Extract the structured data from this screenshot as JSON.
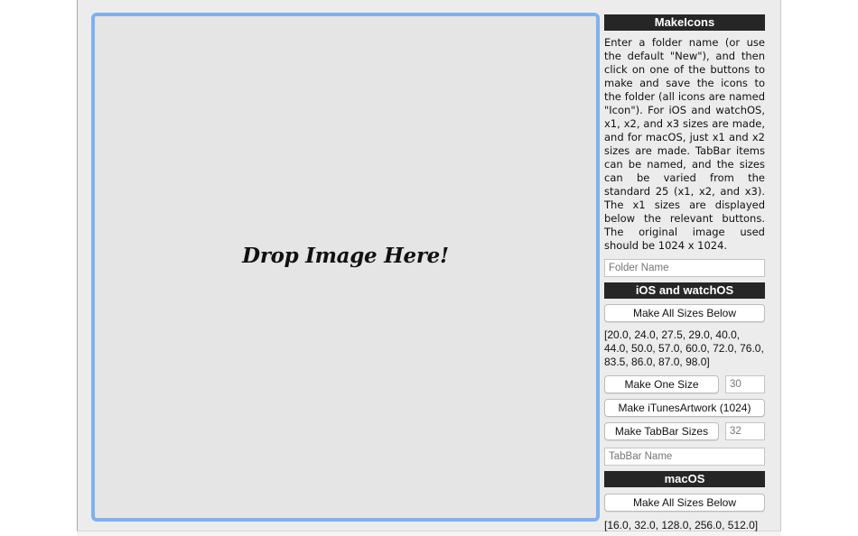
{
  "drop_zone": {
    "label": "Drop Image Here!"
  },
  "panel": {
    "title": "MakeIcons",
    "description": "Enter a folder name (or use the default \"New\"), and then click on one of the buttons to make and save the icons to the folder (all icons are named \"Icon\"). For iOS and watchOS, x1, x2, and x3 sizes are made, and for macOS, just x1 and x2 sizes are made. TabBar items can be named, and the sizes can be varied from the standard 25 (x1, x2, and x3). The x1 sizes are displayed below the relevant buttons. The original image used should be 1024 x 1024.",
    "folder_name_placeholder": "Folder Name",
    "ios": {
      "header": "iOS and watchOS",
      "make_all_label": "Make All Sizes Below",
      "sizes_text": "[20.0, 24.0, 27.5, 29.0, 40.0, 44.0, 50.0, 57.0, 60.0, 72.0, 76.0, 83.5, 86.0, 87.0, 98.0]",
      "make_one_label": "Make One Size",
      "one_size_placeholder": "30",
      "itunes_label": "Make iTunesArtwork (1024)",
      "tabbar_label": "Make TabBar Sizes",
      "tabbar_size_placeholder": "32",
      "tabbar_name_placeholder": "TabBar Name"
    },
    "macos": {
      "header": "macOS",
      "make_all_label": "Make All Sizes Below",
      "sizes_text": "[16.0, 32.0, 128.0, 256.0, 512.0]"
    }
  },
  "colors": {
    "window_bg": "#ececec",
    "drop_border": "#7fb1f0",
    "header_bg": "#262626"
  }
}
